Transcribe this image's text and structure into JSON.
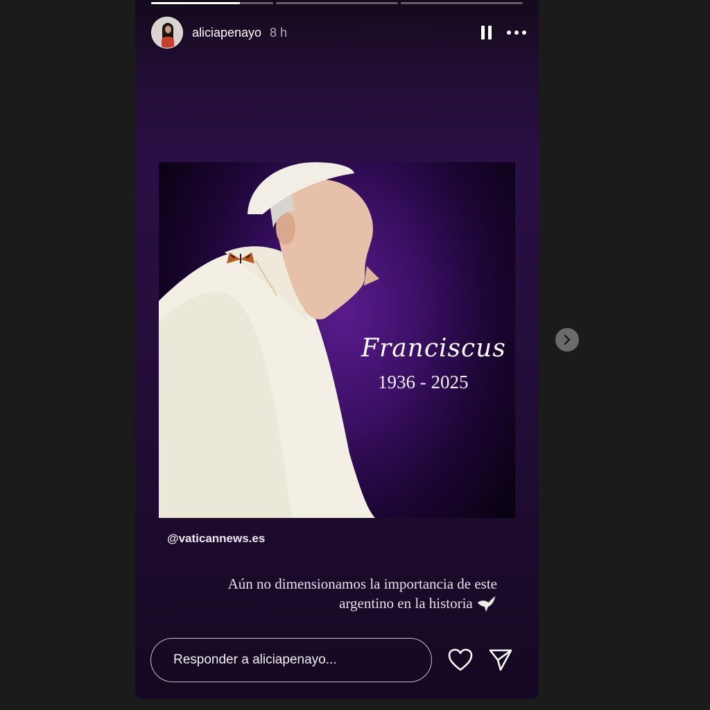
{
  "story": {
    "progress": [
      0.73,
      0,
      0
    ],
    "user": {
      "username": "aliciapenayo",
      "time": "8 h"
    },
    "header_icons": [
      "pause-icon",
      "more-options-icon"
    ],
    "post": {
      "signature": "Franciscus",
      "years": "1936 - 2025",
      "credit": "@vaticannews.es"
    },
    "caption": {
      "line1": "Aún no dimensionamos la importancia de este",
      "line2": "argentino en la historia",
      "emoji": "dove-icon"
    },
    "reply": {
      "placeholder": "Responder a aliciapenayo..."
    },
    "actions": [
      "like-heart-icon",
      "share-send-icon"
    ]
  },
  "navigation": {
    "next": "chevron-right-icon"
  },
  "colors": {
    "background": "#1b1b1b",
    "story_purple": "#2a0f45",
    "post_purple": "#5a1b8c",
    "text": "#ffffff"
  }
}
